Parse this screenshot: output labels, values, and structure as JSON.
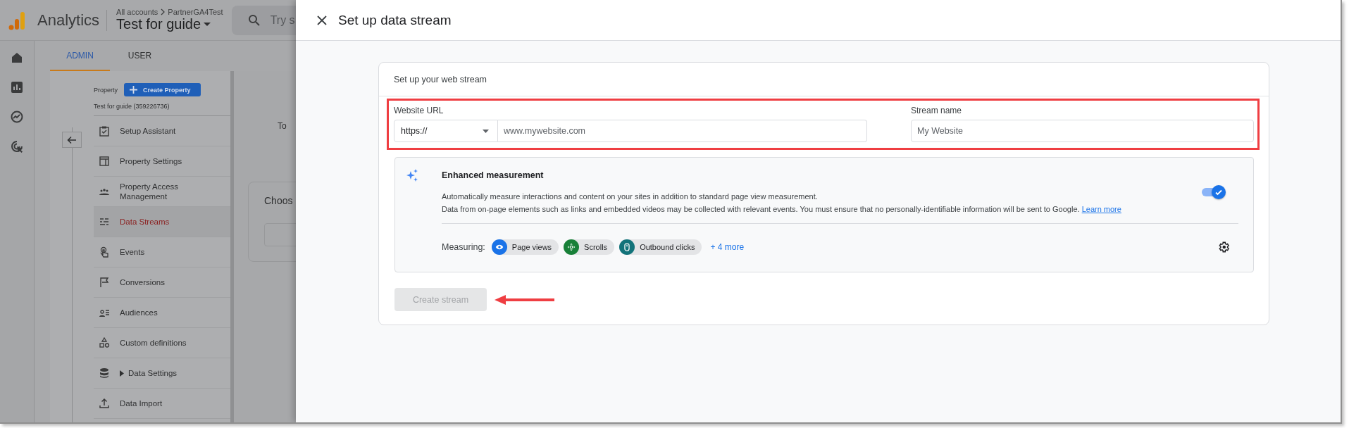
{
  "app": {
    "product": "Analytics",
    "breadcrumb": [
      "All accounts",
      "PartnerGA4Test"
    ],
    "property_name": "Test for guide",
    "search_placeholder": "Try s",
    "tabs": [
      {
        "label": "ADMIN",
        "selected": true
      },
      {
        "label": "USER",
        "selected": false
      }
    ],
    "property_label": "Property",
    "create_button": "Create Property",
    "property_id": "Test for guide (359226736)",
    "nav_items": [
      {
        "label": "Setup Assistant",
        "kind": "checklist",
        "selected": false
      },
      {
        "label": "Property Settings",
        "kind": "layout",
        "selected": false
      },
      {
        "label": "Property Access Management",
        "kind": "people",
        "selected": false
      },
      {
        "label": "Data Streams",
        "kind": "streams",
        "selected": true
      },
      {
        "label": "Events",
        "kind": "touch",
        "selected": false
      },
      {
        "label": "Conversions",
        "kind": "flag",
        "selected": false
      },
      {
        "label": "Audiences",
        "kind": "audience",
        "selected": false
      },
      {
        "label": "Custom definitions",
        "kind": "shapes",
        "selected": false
      },
      {
        "label": "Data Settings",
        "kind": "database",
        "selected": false,
        "expandable": true
      },
      {
        "label": "Data Import",
        "kind": "upload",
        "selected": false
      }
    ],
    "content_text": "To",
    "card_title": "Choos"
  },
  "dialog": {
    "title": "Set up data stream",
    "section_title": "Set up your web stream",
    "url_label": "Website URL",
    "protocol": "https://",
    "url_placeholder": "www.mywebsite.com",
    "stream_label": "Stream name",
    "stream_placeholder": "My Website",
    "enhanced": {
      "title": "Enhanced measurement",
      "description": "Automatically measure interactions and content on your sites in addition to standard page view measurement.",
      "note": "Data from on-page elements such as links and embedded videos may be collected with relevant events. You must ensure that no personally-identifiable information will be sent to Google.",
      "link": "Learn more",
      "on": true,
      "measuring_label": "Measuring:",
      "chips": [
        {
          "label": "Page views",
          "kind": "eye",
          "color": "#1a73e8"
        },
        {
          "label": "Scrolls",
          "kind": "scroll",
          "color": "#188038"
        },
        {
          "label": "Outbound clicks",
          "kind": "mouse",
          "color": "#12737a"
        }
      ],
      "more": "+ 4 more"
    },
    "create_button": {
      "label": "Create stream",
      "disabled": true
    }
  }
}
